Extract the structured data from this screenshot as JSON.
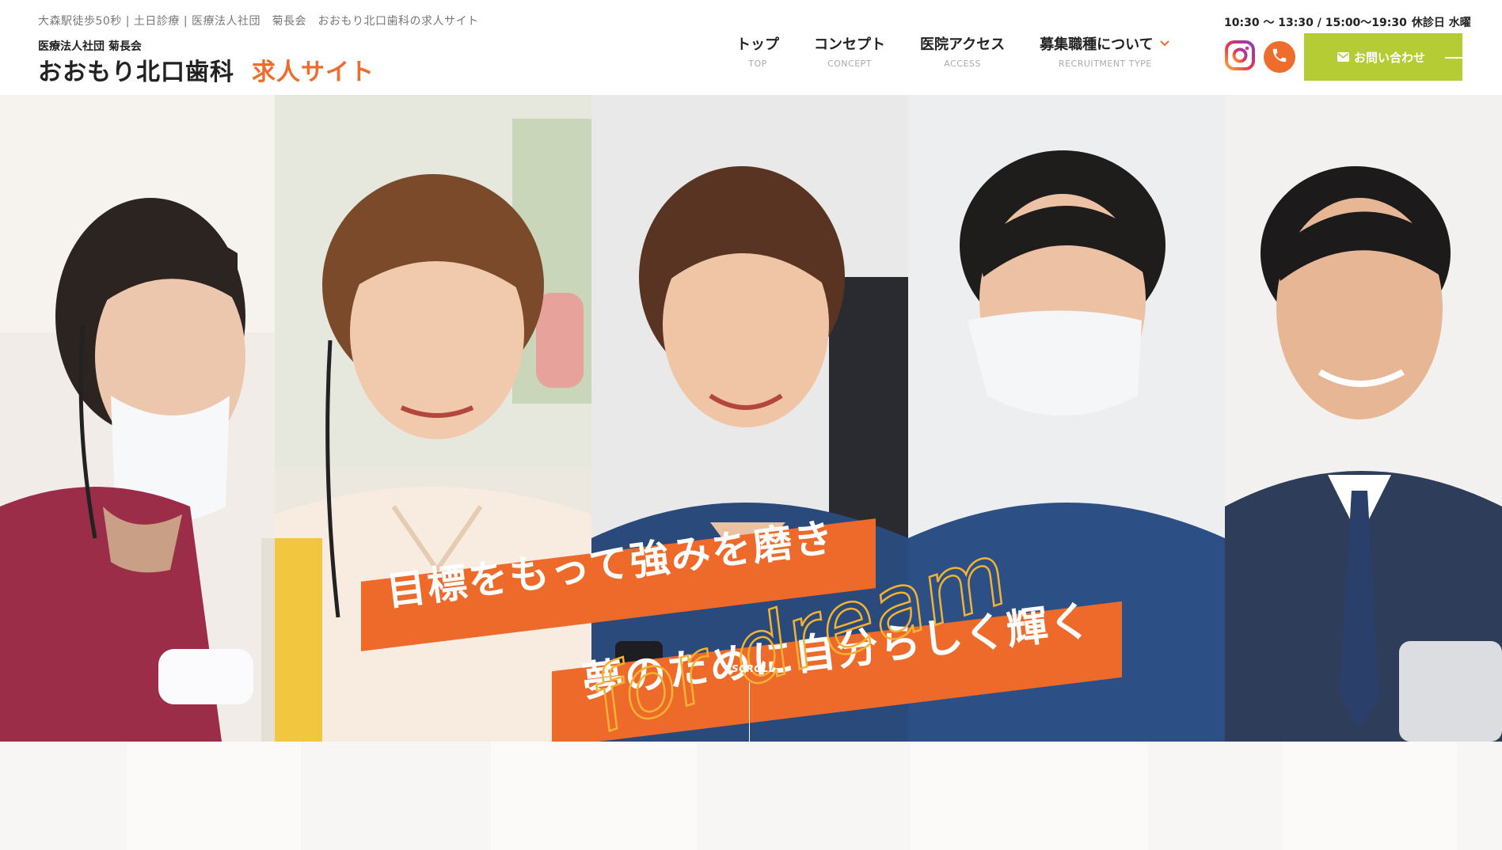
{
  "header": {
    "tagline": "大森駅徒歩50秒 | 土日診療 | 医療法人社団　菊長会　おおもり北口歯科の求人サイト",
    "corp_name": "医療法人社団 菊長会",
    "clinic_name": "おおもり北口歯科",
    "site_label": "求人サイト",
    "hours": "10:30 〜 13:30 / 15:00〜19:30",
    "closed_label": "休診日 水曜",
    "contact_label": "お問い合わせ"
  },
  "nav": [
    {
      "jp": "トップ",
      "en": "TOP"
    },
    {
      "jp": "コンセプト",
      "en": "CONCEPT"
    },
    {
      "jp": "医院アクセス",
      "en": "ACCESS"
    },
    {
      "jp": "募集職種について",
      "en": "RECRUITMENT TYPE"
    }
  ],
  "hero": {
    "copy_line1": "目標をもって強みを磨き",
    "copy_line2": "夢のために自分らしく輝く",
    "script_text": "for dream",
    "scroll_label": "SCROLL"
  },
  "colors": {
    "accent_orange": "#ee6d2c",
    "contact_green": "#b5cc35",
    "script_yellow": "#f2b233"
  },
  "icons": [
    "instagram-icon",
    "phone-icon",
    "mail-icon",
    "chevron-down-icon"
  ]
}
